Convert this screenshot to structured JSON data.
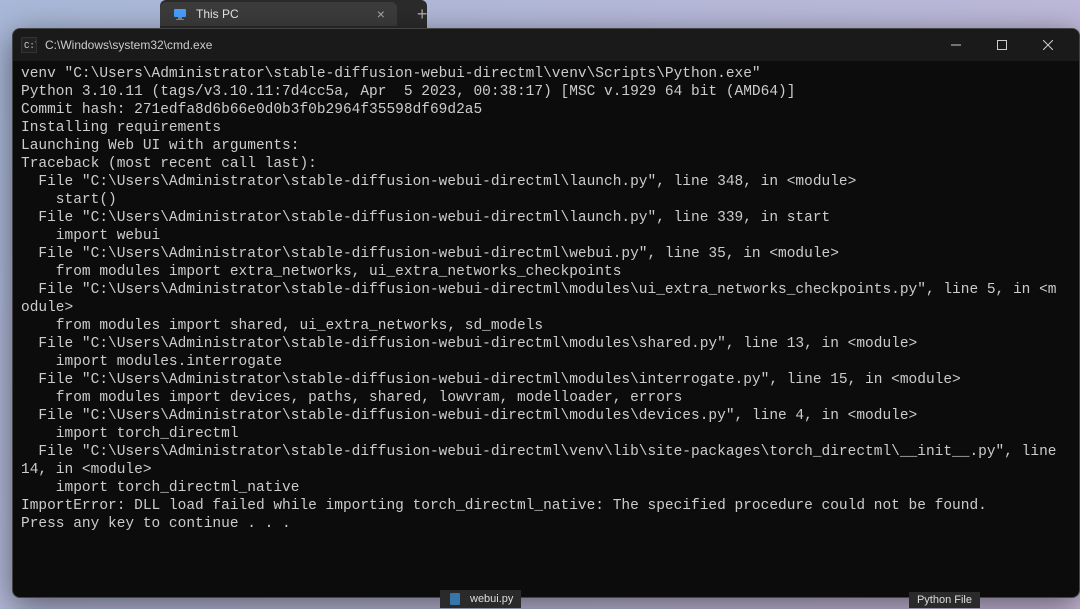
{
  "explorer": {
    "tab_title": "This PC",
    "tab_close": "×",
    "tab_add": "+"
  },
  "cmd": {
    "title": "C:\\Windows\\system32\\cmd.exe",
    "minimize": "—",
    "maximize": "☐",
    "lines": [
      "venv \"C:\\Users\\Administrator\\stable-diffusion-webui-directml\\venv\\Scripts\\Python.exe\"",
      "Python 3.10.11 (tags/v3.10.11:7d4cc5a, Apr  5 2023, 00:38:17) [MSC v.1929 64 bit (AMD64)]",
      "Commit hash: 271edfa8d6b66e0d0b3f0b2964f35598df69d2a5",
      "Installing requirements",
      "Launching Web UI with arguments:",
      "Traceback (most recent call last):",
      "  File \"C:\\Users\\Administrator\\stable-diffusion-webui-directml\\launch.py\", line 348, in <module>",
      "    start()",
      "  File \"C:\\Users\\Administrator\\stable-diffusion-webui-directml\\launch.py\", line 339, in start",
      "    import webui",
      "  File \"C:\\Users\\Administrator\\stable-diffusion-webui-directml\\webui.py\", line 35, in <module>",
      "    from modules import extra_networks, ui_extra_networks_checkpoints",
      "  File \"C:\\Users\\Administrator\\stable-diffusion-webui-directml\\modules\\ui_extra_networks_checkpoints.py\", line 5, in <m",
      "odule>",
      "    from modules import shared, ui_extra_networks, sd_models",
      "  File \"C:\\Users\\Administrator\\stable-diffusion-webui-directml\\modules\\shared.py\", line 13, in <module>",
      "    import modules.interrogate",
      "  File \"C:\\Users\\Administrator\\stable-diffusion-webui-directml\\modules\\interrogate.py\", line 15, in <module>",
      "    from modules import devices, paths, shared, lowvram, modelloader, errors",
      "  File \"C:\\Users\\Administrator\\stable-diffusion-webui-directml\\modules\\devices.py\", line 4, in <module>",
      "    import torch_directml",
      "  File \"C:\\Users\\Administrator\\stable-diffusion-webui-directml\\venv\\lib\\site-packages\\torch_directml\\__init__.py\", line",
      "14, in <module>",
      "    import torch_directml_native",
      "ImportError: DLL load failed while importing torch_directml_native: The specified procedure could not be found.",
      "Press any key to continue . . ."
    ]
  },
  "file_explorer": {
    "filename": "webui.py",
    "filetype": "Python File"
  }
}
